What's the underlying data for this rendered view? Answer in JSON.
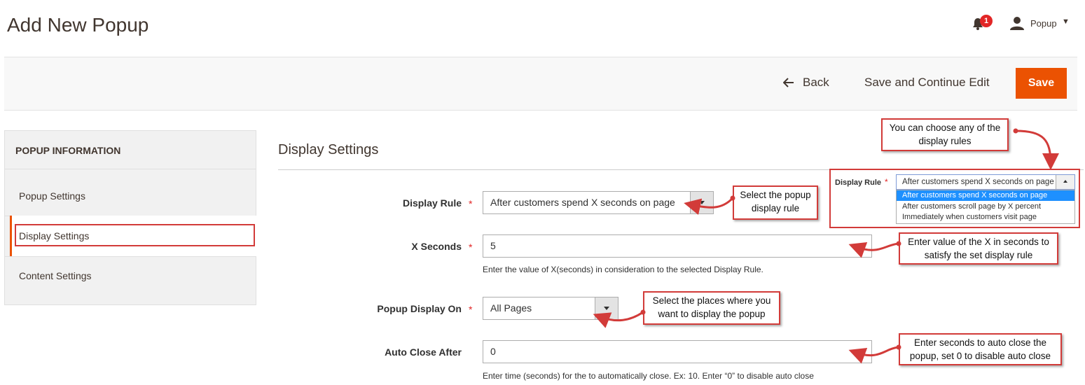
{
  "header": {
    "title": "Add New Popup",
    "notification_count": "1",
    "user_name": "Popup"
  },
  "actions": {
    "back_label": "Back",
    "save_continue_label": "Save and Continue Edit",
    "save_label": "Save"
  },
  "sidebar": {
    "title": "POPUP INFORMATION",
    "items": [
      {
        "label": "Popup Settings"
      },
      {
        "label": "Display Settings"
      },
      {
        "label": "Content Settings"
      }
    ]
  },
  "section": {
    "title": "Display Settings"
  },
  "form": {
    "display_rule": {
      "label": "Display Rule",
      "value": "After customers spend X seconds on page"
    },
    "x_seconds": {
      "label": "X Seconds",
      "value": "5",
      "note": "Enter the value of X(seconds) in consideration to the selected Display Rule."
    },
    "popup_display_on": {
      "label": "Popup Display On",
      "value": "All Pages"
    },
    "auto_close_after": {
      "label": "Auto Close After",
      "value": "0",
      "note": "Enter time (seconds) for the to automatically close. Ex: 10. Enter “0” to disable auto close"
    }
  },
  "dropdown_preview": {
    "label": "Display Rule",
    "selected": "After customers spend X seconds on page",
    "options": [
      "After customers spend X seconds on page",
      "After customers scroll page by X percent",
      "Immediately when customers visit page"
    ]
  },
  "callouts": {
    "choose_rules": "You can choose any of the display rules",
    "select_rule": "Select the popup display rule",
    "enter_seconds": "Enter value of the X in seconds to satisfy the set display rule",
    "select_places": "Select the places where you want to display the popup",
    "auto_close": "Enter seconds to auto close the popup, set 0 to disable auto close"
  },
  "colors": {
    "accent": "#eb5202",
    "callout_border": "#d23b39",
    "required": "#e22626"
  }
}
